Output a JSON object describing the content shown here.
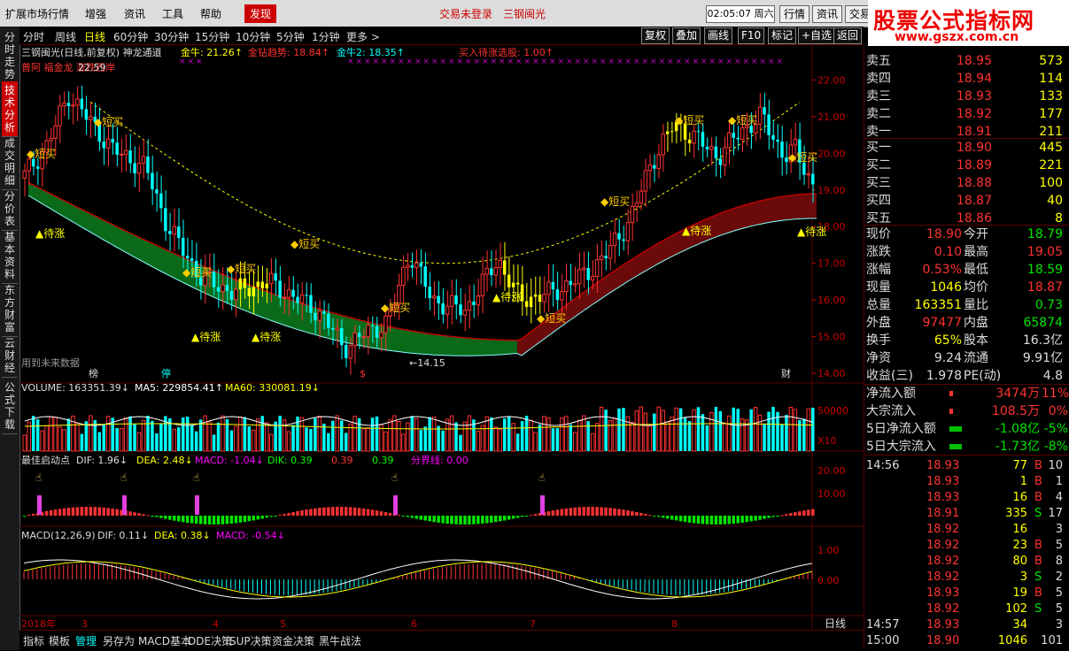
{
  "menubar": {
    "items": [
      "扩展市场行情",
      "增强",
      "资讯",
      "工具",
      "帮助"
    ],
    "active": "发现",
    "title": "交易未登录　三钢闽光",
    "clock": "02:05:07 周六",
    "buttons": [
      "行情",
      "资讯",
      "交易"
    ]
  },
  "brand": {
    "name": "股票公式指标网",
    "url": "www.gszx.com.cn"
  },
  "sidetabs": [
    "分时走势",
    "技术分析",
    "成交明细",
    "分价表",
    "基本资料",
    "东方财富",
    "云财经",
    "公式下载"
  ],
  "period": {
    "tabs": [
      "分时",
      "周线",
      "日线",
      "60分钟",
      "30分钟",
      "15分钟",
      "10分钟",
      "5分钟",
      "1分钟",
      "更多 >"
    ],
    "active": "日线",
    "right_buttons": [
      "复权",
      "叠加",
      "画线",
      "F10",
      "标记",
      "+自选",
      "返回"
    ]
  },
  "main_chart": {
    "title": "三钢闽光(日线,前复权) 神龙通道",
    "legend": [
      {
        "text": "金牛: 21.26↑",
        "color": "#ffff00"
      },
      {
        "text": "金钻趋势: 18.84↑",
        "color": "#ff3232"
      },
      {
        "text": "金牛2: 18.35↑",
        "color": "#00ffff"
      },
      {
        "text": "买入待涨选股: 1.00↑",
        "color": "#ff3232"
      }
    ],
    "subtitle": "普阿 福金龙 涨跌西岸",
    "high_label": "22.59",
    "low_label": "14.15",
    "note": "用到未来数据",
    "markers": [
      "榜",
      "停",
      "$",
      "财"
    ],
    "signals": {
      "short_buy": "短买",
      "wait_rise": "待涨",
      "buy": "买"
    },
    "yaxis": [
      "22.00",
      "21.00",
      "20.00",
      "19.00",
      "18.00",
      "17.00",
      "16.00",
      "15.00",
      "14.00"
    ]
  },
  "volume_chart": {
    "legend": [
      {
        "text": "VOLUME: 163351.39↓",
        "color": "#dddddd"
      },
      {
        "text": "MA5: 229854.41↑",
        "color": "#ffffff"
      },
      {
        "text": "MA60: 330081.19↓",
        "color": "#ffff00"
      }
    ],
    "yaxis": [
      "50000",
      "X10"
    ]
  },
  "dif_chart": {
    "legend": [
      {
        "text": "最佳启动点",
        "color": "#dddddd"
      },
      {
        "text": "DIF: 1.96↓",
        "color": "#dddddd"
      },
      {
        "text": "DEA: 2.48↓",
        "color": "#ffff00"
      },
      {
        "text": "MACD: -1.04↓",
        "color": "#ff00ff"
      },
      {
        "text": "DIK: 0.39",
        "color": "#00ff00"
      },
      {
        "text": "0.39",
        "color": "#ff3232"
      },
      {
        "text": "0.39",
        "color": "#00ff00"
      },
      {
        "text": "分界线: 0.00",
        "color": "#ff00ff"
      }
    ],
    "yaxis": [
      "20.00",
      "10.00"
    ]
  },
  "macd_chart": {
    "legend": [
      {
        "text": "MACD(12,26,9)",
        "color": "#dddddd"
      },
      {
        "text": "DIF: 0.11↓",
        "color": "#dddddd"
      },
      {
        "text": "DEA: 0.38↓",
        "color": "#ffff00"
      },
      {
        "text": "MACD: -0.54↓",
        "color": "#ff00ff"
      }
    ],
    "yaxis": [
      "1.00",
      "0.00"
    ]
  },
  "xaxis": {
    "labels": [
      "2018年",
      "3",
      "4",
      "5",
      "6",
      "7",
      "8"
    ],
    "period": "日线"
  },
  "bottom_tabs": [
    "指标",
    "模板",
    "管理",
    "另存为",
    "MACD基本",
    "DDE决策",
    "SUP决策",
    "资金决策",
    "黑牛战法"
  ],
  "bottom_active": "管理",
  "quote": {
    "asks": [
      {
        "label": "卖五",
        "price": "18.95",
        "vol": "573"
      },
      {
        "label": "卖四",
        "price": "18.94",
        "vol": "114"
      },
      {
        "label": "卖三",
        "price": "18.93",
        "vol": "133"
      },
      {
        "label": "卖二",
        "price": "18.92",
        "vol": "177"
      },
      {
        "label": "卖一",
        "price": "18.91",
        "vol": "211"
      }
    ],
    "bids": [
      {
        "label": "买一",
        "price": "18.90",
        "vol": "445"
      },
      {
        "label": "买二",
        "price": "18.89",
        "vol": "221"
      },
      {
        "label": "买三",
        "price": "18.88",
        "vol": "100"
      },
      {
        "label": "买四",
        "price": "18.87",
        "vol": "40"
      },
      {
        "label": "买五",
        "price": "18.86",
        "vol": "8"
      }
    ],
    "stats": [
      {
        "k1": "现价",
        "v1": "18.90",
        "c1": "red",
        "k2": "今开",
        "v2": "18.79",
        "c2": "green"
      },
      {
        "k1": "涨跌",
        "v1": "0.10",
        "c1": "red",
        "k2": "最高",
        "v2": "19.05",
        "c2": "red"
      },
      {
        "k1": "涨幅",
        "v1": "0.53%",
        "c1": "red",
        "k2": "最低",
        "v2": "18.59",
        "c2": "green"
      },
      {
        "k1": "现量",
        "v1": "1046",
        "c1": "yellow",
        "k2": "均价",
        "v2": "18.87",
        "c2": "red"
      },
      {
        "k1": "总量",
        "v1": "163351",
        "c1": "yellow",
        "k2": "量比",
        "v2": "0.73",
        "c2": "green"
      },
      {
        "k1": "外盘",
        "v1": "97477",
        "c1": "red",
        "k2": "内盘",
        "v2": "65874",
        "c2": "green"
      },
      {
        "k1": "换手",
        "v1": "65%",
        "c1": "yellow",
        "k2": "股本",
        "v2": "16.3亿",
        "c2": "white"
      },
      {
        "k1": "净资",
        "v1": "9.24",
        "c1": "white",
        "k2": "流通",
        "v2": "9.91亿",
        "c2": "white"
      },
      {
        "k1": "收益(三)",
        "v1": "1.978",
        "c1": "white",
        "k2": "PE(动)",
        "v2": "4.8",
        "c2": "white"
      }
    ],
    "flows": [
      {
        "k": "净流入额",
        "v": "3474万",
        "p": "11%",
        "c": "red"
      },
      {
        "k": "大宗流入",
        "v": "108.5万",
        "p": "0%",
        "c": "red"
      },
      {
        "k": "5日净流入额",
        "v": "-1.08亿",
        "p": "-5%",
        "c": "green"
      },
      {
        "k": "5日大宗流入",
        "v": "-1.73亿",
        "p": "-8%",
        "c": "green"
      }
    ],
    "ticks": [
      {
        "t": "14:56",
        "p": "18.93",
        "v": "77",
        "bs": "B",
        "n": "10"
      },
      {
        "t": "",
        "p": "18.93",
        "v": "1",
        "bs": "B",
        "n": "1"
      },
      {
        "t": "",
        "p": "18.93",
        "v": "16",
        "bs": "B",
        "n": "4"
      },
      {
        "t": "",
        "p": "18.91",
        "v": "335",
        "bs": "S",
        "n": "17"
      },
      {
        "t": "",
        "p": "18.92",
        "v": "16",
        "bs": "",
        "n": "3"
      },
      {
        "t": "",
        "p": "18.92",
        "v": "23",
        "bs": "B",
        "n": "5"
      },
      {
        "t": "",
        "p": "18.92",
        "v": "80",
        "bs": "B",
        "n": "8"
      },
      {
        "t": "",
        "p": "18.92",
        "v": "3",
        "bs": "S",
        "n": "2"
      },
      {
        "t": "",
        "p": "18.93",
        "v": "19",
        "bs": "B",
        "n": "5"
      },
      {
        "t": "",
        "p": "18.92",
        "v": "102",
        "bs": "S",
        "n": "5"
      },
      {
        "t": "14:57",
        "p": "18.93",
        "v": "34",
        "bs": "",
        "n": "3"
      },
      {
        "t": "15:00",
        "p": "18.90",
        "v": "1046",
        "bs": "",
        "n": "101"
      }
    ]
  },
  "colors": {
    "up": "#ff3232",
    "down": "#00ffff",
    "accent": "#cc0000",
    "grid": "#5a0000"
  }
}
